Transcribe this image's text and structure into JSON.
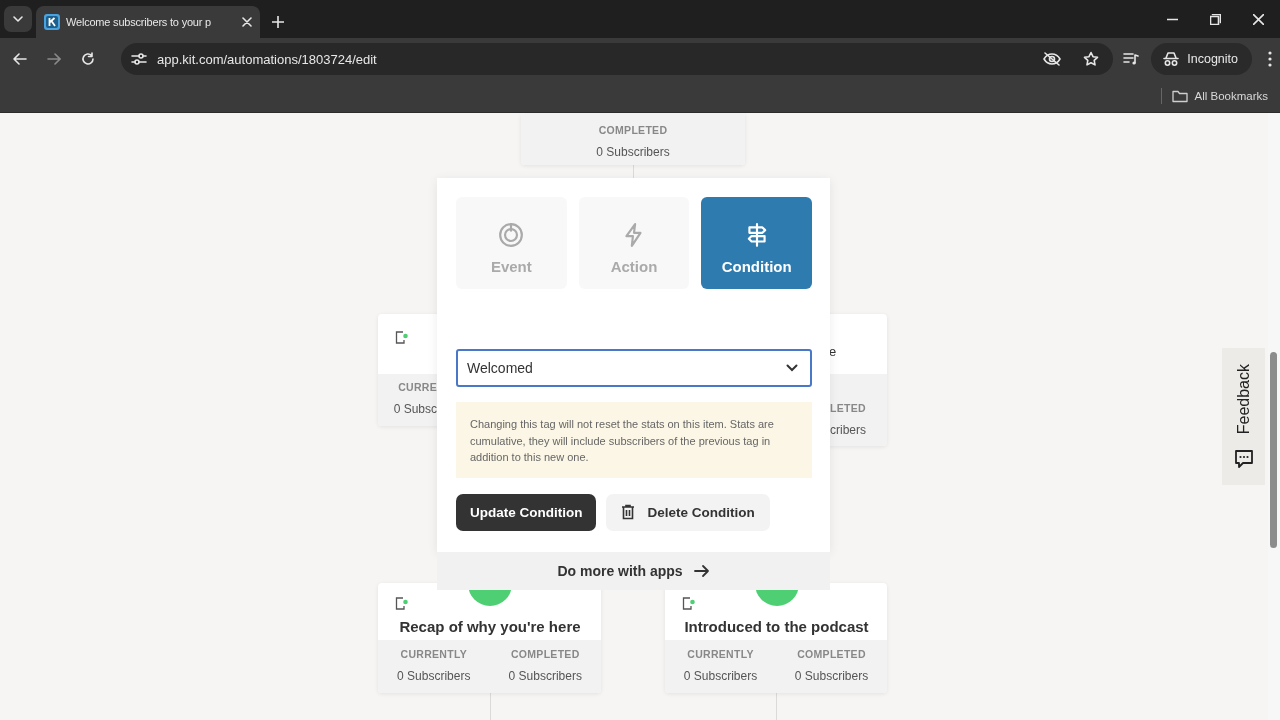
{
  "browser": {
    "tab_title": "Welcome subscribers to your p",
    "url": "app.kit.com/automations/1803724/edit",
    "profile_label": "Incognito",
    "bookmarks_label": "All Bookmarks"
  },
  "canvas": {
    "nodes": [
      {
        "stats": [
          {
            "label": "COMPLETED",
            "value": "0 Subscribers"
          }
        ]
      },
      {
        "stats": [
          {
            "label": "CURRE",
            "value": "0 Subsc"
          }
        ]
      },
      {
        "title": "e",
        "stats": [
          {
            "label": "LETED",
            "value": "cribers"
          }
        ]
      },
      {
        "title": "Recap of why you're here",
        "stats": [
          {
            "label": "CURRENTLY",
            "value": "0 Subscribers"
          },
          {
            "label": "COMPLETED",
            "value": "0 Subscribers"
          }
        ]
      },
      {
        "title": "Introduced to the podcast",
        "stats": [
          {
            "label": "CURRENTLY",
            "value": "0 Subscribers"
          },
          {
            "label": "COMPLETED",
            "value": "0 Subscribers"
          }
        ]
      }
    ]
  },
  "popover": {
    "tabs": [
      {
        "label": "Event",
        "kind": "event",
        "selected": false
      },
      {
        "label": "Action",
        "kind": "action",
        "selected": false
      },
      {
        "label": "Condition",
        "kind": "condition",
        "selected": true
      }
    ],
    "select": {
      "value": "Welcomed"
    },
    "notice": "Changing this tag will not reset the stats on this item. Stats are cumulative, they will include subscribers of the previous tag in addition to this new one.",
    "buttons": [
      {
        "label": "Update Condition",
        "kind": "primary"
      },
      {
        "label": "Delete Condition",
        "kind": "secondary"
      }
    ],
    "footer_link": "Do more with apps"
  },
  "feedback": {
    "label": "Feedback"
  }
}
